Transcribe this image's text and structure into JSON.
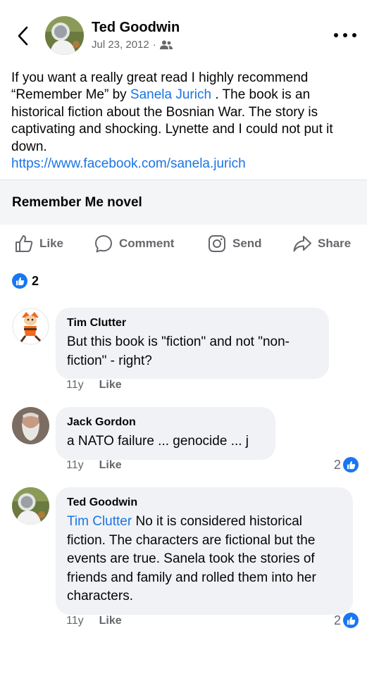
{
  "header": {
    "author": "Ted Goodwin",
    "date": "Jul 23, 2012",
    "separator": "·",
    "audience_icon": "friends-icon"
  },
  "post": {
    "text_1": "If you want a really great read I highly recommend “Remember Me” by ",
    "mention": "Sanela Jurich",
    "text_2": " . The book is an historical fiction about the Bosnian War. The story is captivating and shocking. Lynette and I could not put it down.",
    "link": "https://www.facebook.com/sanela.jurich"
  },
  "link_card": {
    "title": "Remember Me novel"
  },
  "actions": {
    "like": "Like",
    "comment": "Comment",
    "send": "Send",
    "share": "Share"
  },
  "reactions": {
    "count": "2"
  },
  "comments": [
    {
      "name": "Tim Clutter",
      "mention": "",
      "text": "But this book is \"fiction\" and not \"non-fiction\" - right?",
      "age": "11y",
      "like_label": "Like",
      "reactions": ""
    },
    {
      "name": "Jack Gordon",
      "mention": "",
      "text": "a NATO failure ... genocide ... j",
      "age": "11y",
      "like_label": "Like",
      "reactions": "2"
    },
    {
      "name": "Ted Goodwin",
      "mention": "Tim Clutter",
      "text": " No it is considered historical fiction. The characters are fictional but the events are true. Sanela took the stories of friends and family and rolled them into her characters.",
      "age": "11y",
      "like_label": "Like",
      "reactions": "2"
    }
  ],
  "colors": {
    "link": "#1b74e4",
    "like_blue": "#1877f2",
    "secondary_text": "#65676b",
    "bubble": "#f0f2f5"
  }
}
